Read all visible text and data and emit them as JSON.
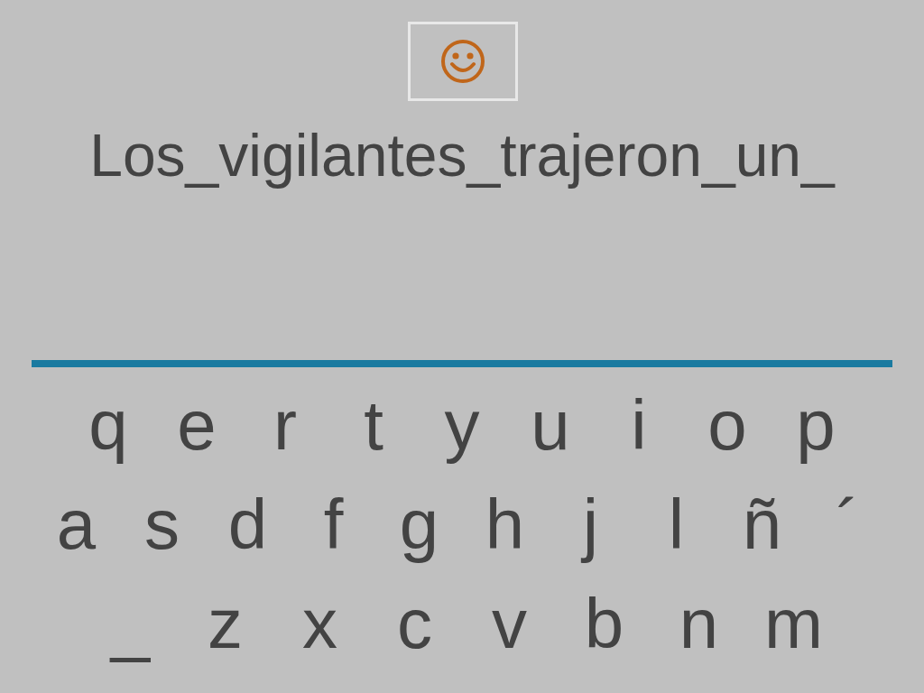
{
  "sentence": "Los_vigilantes_trajeron_un_",
  "keyboard": {
    "rows": [
      [
        "q",
        "e",
        "r",
        "t",
        "y",
        "u",
        "i",
        "o",
        "p"
      ],
      [
        "a",
        "s",
        "d",
        "f",
        "g",
        "h",
        "j",
        "l",
        "ñ",
        "´"
      ],
      [
        "_",
        "z",
        "x",
        "c",
        "v",
        "b",
        "n",
        "m"
      ]
    ]
  }
}
